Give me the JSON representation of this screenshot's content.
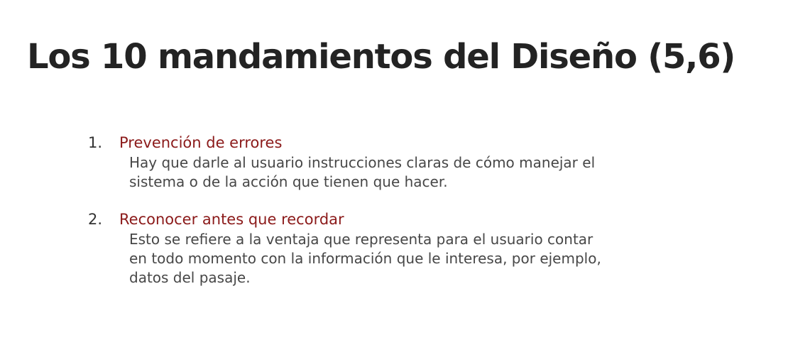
{
  "slide": {
    "title": "Los 10 mandamientos del Diseño (5,6)"
  },
  "items": [
    {
      "number": "1.",
      "heading": "Prevención de errores",
      "lines": [
        "Hay que darle al usuario instrucciones claras de cómo manejar el",
        "sistema o de la acción que tienen que hacer."
      ]
    },
    {
      "number": "2.",
      "heading": "Reconocer antes que recordar",
      "lines": [
        "Esto se refiere a la ventaja que representa para el usuario contar",
        "en todo momento con la información que le interesa, por ejemplo,",
        "datos del pasaje."
      ]
    }
  ],
  "colors": {
    "title": "#232323",
    "heading_accent": "#8b1a1a",
    "body_text": "#474747"
  }
}
